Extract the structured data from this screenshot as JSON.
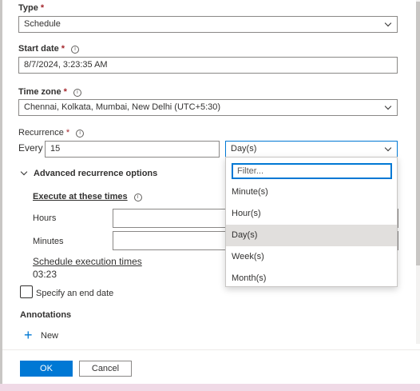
{
  "type": {
    "label": "Type",
    "required": "*",
    "value": "Schedule"
  },
  "start_date": {
    "label": "Start date",
    "required": "*",
    "value": "8/7/2024, 3:23:35 AM"
  },
  "time_zone": {
    "label": "Time zone",
    "required": "*",
    "value": "Chennai, Kolkata, Mumbai, New Delhi (UTC+5:30)"
  },
  "recurrence": {
    "label": "Recurrence",
    "required": "*",
    "every_label": "Every",
    "interval_value": "15",
    "unit_value": "Day(s)",
    "dropdown": {
      "filter_placeholder": "Filter...",
      "options": [
        "Minute(s)",
        "Hour(s)",
        "Day(s)",
        "Week(s)",
        "Month(s)"
      ],
      "selected": "Day(s)"
    }
  },
  "advanced": {
    "toggle_label": "Advanced recurrence options",
    "execute_label": "Execute at these times",
    "hours_label": "Hours",
    "minutes_label": "Minutes",
    "schedule_times_label": "Schedule execution times",
    "schedule_times_value": "03:23"
  },
  "end_date": {
    "label": "Specify an end date",
    "checked": false
  },
  "annotations": {
    "label": "Annotations",
    "new_label": "New"
  },
  "footer": {
    "ok_label": "OK",
    "cancel_label": "Cancel"
  },
  "colors": {
    "accent": "#0078d4",
    "required": "#a4262c",
    "selected_option": "#e1dfdd"
  }
}
